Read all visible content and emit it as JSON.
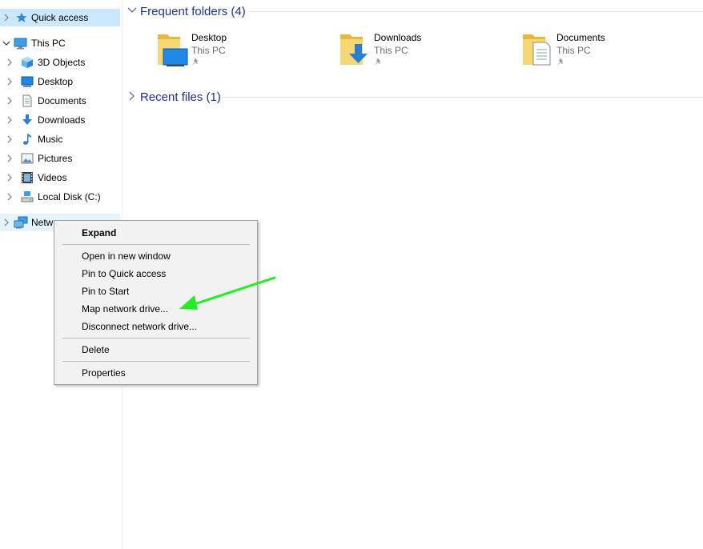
{
  "nav": {
    "items": [
      {
        "label": "Quick access",
        "icon": "star-icon"
      },
      {
        "label": "This PC",
        "icon": "computer-icon"
      },
      {
        "label": "3D Objects",
        "icon": "cube-icon"
      },
      {
        "label": "Desktop",
        "icon": "desktop-icon"
      },
      {
        "label": "Documents",
        "icon": "document-icon"
      },
      {
        "label": "Downloads",
        "icon": "download-icon"
      },
      {
        "label": "Music",
        "icon": "music-note-icon"
      },
      {
        "label": "Pictures",
        "icon": "picture-icon"
      },
      {
        "label": "Videos",
        "icon": "film-icon"
      },
      {
        "label": "Local Disk (C:)",
        "icon": "drive-icon"
      },
      {
        "label": "Netw",
        "icon": "network-icon"
      }
    ]
  },
  "main": {
    "frequent_title": "Frequent folders (4)",
    "recent_title": "Recent files (1)",
    "folders": [
      {
        "name": "Desktop",
        "location": "This PC",
        "icon": "desktop-folder-icon"
      },
      {
        "name": "Downloads",
        "location": "This PC",
        "icon": "downloads-folder-icon"
      },
      {
        "name": "Documents",
        "location": "This PC",
        "icon": "documents-folder-icon"
      }
    ]
  },
  "context_menu": {
    "items": [
      "Expand",
      "Open in new window",
      "Pin to Quick access",
      "Pin to Start",
      "Map network drive...",
      "Disconnect network drive...",
      "Delete",
      "Properties"
    ]
  },
  "colors": {
    "selection": "#cce8ff",
    "hover": "#e5f3ff",
    "group_title": "#1e3287",
    "annotation_arrow": "#22ee22"
  }
}
